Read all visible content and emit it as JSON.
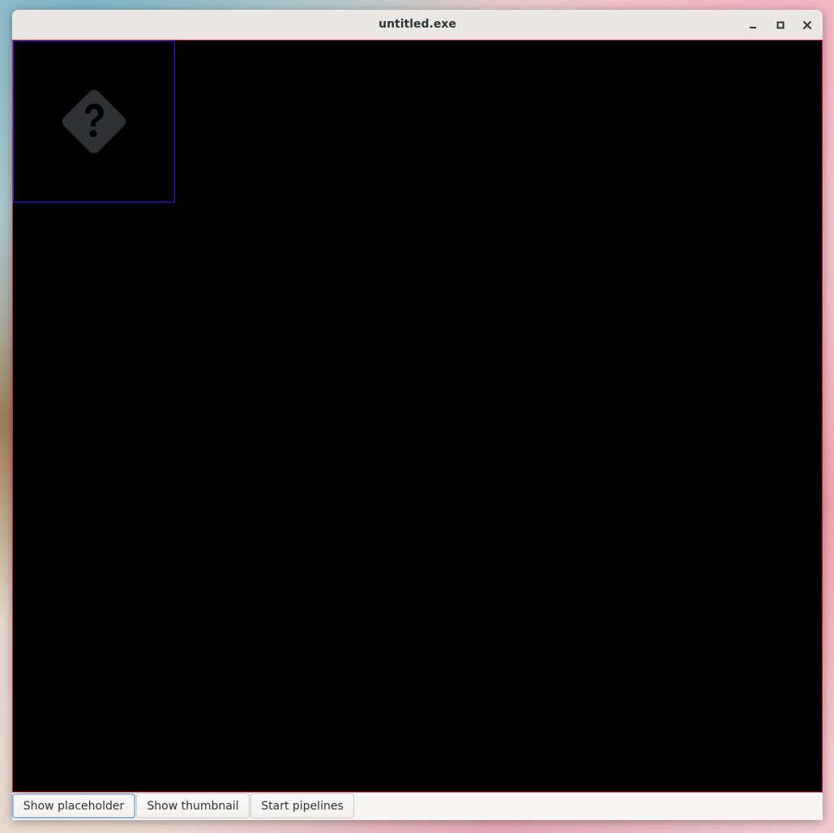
{
  "window": {
    "title": "untitled.exe",
    "controls": {
      "minimize_icon": "minimize-icon",
      "maximize_icon": "maximize-icon",
      "close_icon": "close-icon"
    }
  },
  "canvas": {
    "background": "#000000",
    "border_color": "#e01b24",
    "placeholder": {
      "icon": "missing-image-icon",
      "border_color": "#1c1cf0"
    }
  },
  "toolbar": {
    "buttons": [
      {
        "label": "Show placeholder"
      },
      {
        "label": "Show thumbnail"
      },
      {
        "label": "Start pipelines"
      }
    ]
  }
}
